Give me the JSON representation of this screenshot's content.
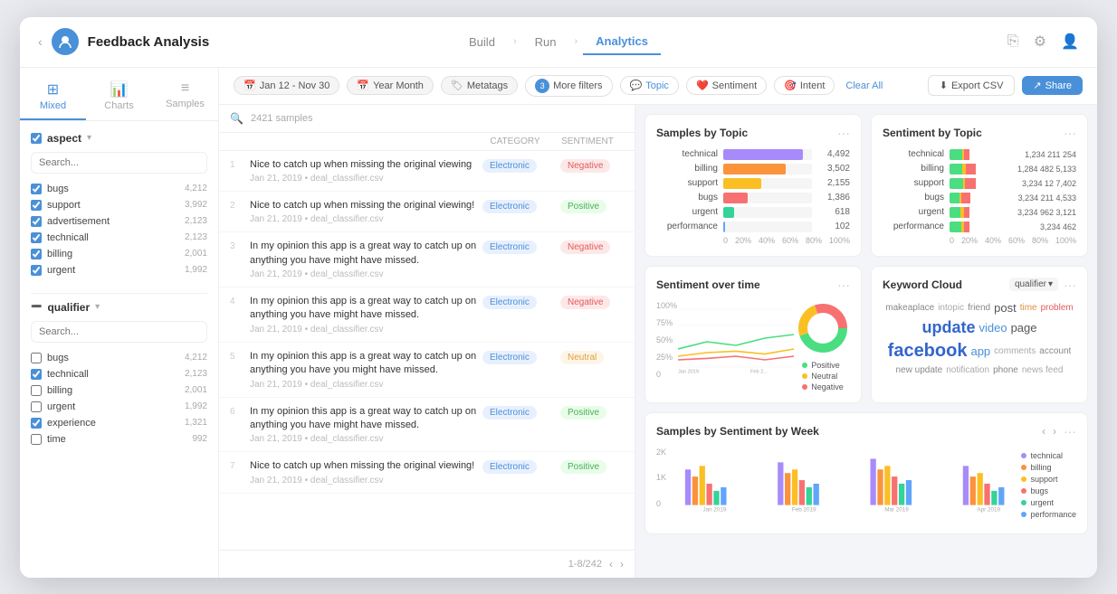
{
  "app": {
    "title": "Feedback Analysis",
    "nav": {
      "back": "‹",
      "items": [
        {
          "label": "Build",
          "active": false
        },
        {
          "label": "Run",
          "active": false
        },
        {
          "label": "Analytics",
          "active": true
        }
      ]
    },
    "toolbar_icons": [
      "copy-icon",
      "settings-icon",
      "user-icon"
    ]
  },
  "sidebar": {
    "tabs": [
      {
        "label": "Mixed",
        "icon": "⊞",
        "active": true
      },
      {
        "label": "Charts",
        "icon": "📊",
        "active": false
      },
      {
        "label": "Samples",
        "icon": "≡",
        "active": false
      }
    ],
    "aspect_group": {
      "title": "aspect",
      "search_placeholder": "Search...",
      "items": [
        {
          "label": "bugs",
          "count": "4,212",
          "checked": true
        },
        {
          "label": "support",
          "count": "3,992",
          "checked": true
        },
        {
          "label": "advertisement",
          "count": "2,123",
          "checked": true
        },
        {
          "label": "technicall",
          "count": "2,123",
          "checked": true
        },
        {
          "label": "billing",
          "count": "2,001",
          "checked": true
        },
        {
          "label": "urgent",
          "count": "1,992",
          "checked": true
        }
      ]
    },
    "qualifier_group": {
      "title": "qualifier",
      "search_placeholder": "Search...",
      "items": [
        {
          "label": "bugs",
          "count": "4,212",
          "checked": false
        },
        {
          "label": "technicall",
          "count": "2,123",
          "checked": true
        },
        {
          "label": "billing",
          "count": "2,001",
          "checked": false
        },
        {
          "label": "urgent",
          "count": "1,992",
          "checked": false
        },
        {
          "label": "experience",
          "count": "1,321",
          "checked": true
        },
        {
          "label": "time",
          "count": "992",
          "checked": false
        }
      ]
    }
  },
  "filter_bar": {
    "date_range": "Jan 12 - Nov 30",
    "period": "Year Month",
    "metatags": "Metatags",
    "more_filters_count": "3",
    "more_filters_label": "More filters",
    "topic_label": "Topic",
    "sentiment_label": "Sentiment",
    "intent_label": "Intent",
    "clear_all": "Clear All",
    "export_csv": "Export CSV",
    "share": "Share"
  },
  "table": {
    "samples_count": "2421 samples",
    "col_category": "CATEGORY",
    "col_sentiment": "SENTIMENT",
    "pagination": "1-8/242",
    "rows": [
      {
        "num": 1,
        "text": "Nice to catch up when missing the original viewing",
        "meta": "Jan 21, 2019 • deal_classifier.csv",
        "category": "Electronic",
        "sentiment": "Negative"
      },
      {
        "num": 2,
        "text": "Nice to catch up when missing the original viewing!",
        "meta": "Jan 21, 2019 • deal_classifier.csv",
        "category": "Electronic",
        "sentiment": "Positive"
      },
      {
        "num": 3,
        "text": "In my opinion this app is a great way to catch up on anything you have might have missed.",
        "meta": "Jan 21, 2019 • deal_classifier.csv",
        "category": "Electronic",
        "sentiment": "Negative"
      },
      {
        "num": 4,
        "text": "In my opinion this app is a great way to catch up on anything you have might have missed.",
        "meta": "Jan 21, 2019 • deal_classifier.csv",
        "category": "Electronic",
        "sentiment": "Negative"
      },
      {
        "num": 5,
        "text": "In my opinion this app is a great way to catch up on anything you have you might have missed.",
        "meta": "Jan 21, 2019 • deal_classifier.csv",
        "category": "Electronic",
        "sentiment": "Neutral"
      },
      {
        "num": 6,
        "text": "In my opinion this app is a great way to catch up on anything you have might have missed.",
        "meta": "Jan 21, 2019 • deal_classifier.csv",
        "category": "Electronic",
        "sentiment": "Positive"
      },
      {
        "num": 7,
        "text": "Nice to catch up when missing the original viewing!",
        "meta": "Jan 21, 2019 • deal_classifier.csv",
        "category": "Electronic",
        "sentiment": "Positive"
      }
    ]
  },
  "charts": {
    "samples_by_topic": {
      "title": "Samples by Topic",
      "rows": [
        {
          "label": "technical",
          "value": "4,492",
          "pct": 90,
          "color": "#a78bfa"
        },
        {
          "label": "billing",
          "value": "3,502",
          "pct": 70,
          "color": "#fb923c"
        },
        {
          "label": "support",
          "value": "2,155",
          "pct": 43,
          "color": "#fbbf24"
        },
        {
          "label": "bugs",
          "value": "1,386",
          "pct": 28,
          "color": "#f87171"
        },
        {
          "label": "urgent",
          "value": "618",
          "pct": 12,
          "color": "#34d399"
        },
        {
          "label": "performance",
          "value": "102",
          "pct": 2,
          "color": "#60a5fa"
        }
      ],
      "x_labels": [
        "0",
        "20%",
        "40%",
        "60%",
        "80%",
        "100%"
      ]
    },
    "sentiment_by_topic": {
      "title": "Sentiment by Topic",
      "rows": [
        {
          "label": "technical",
          "segs": [
            {
              "pct": 25,
              "color": "#4ade80"
            },
            {
              "pct": 5,
              "color": "#fbbf24"
            },
            {
              "pct": 10,
              "color": "#f87171"
            }
          ],
          "values": "1,234  211  254"
        },
        {
          "label": "billing",
          "segs": [
            {
              "pct": 25,
              "color": "#4ade80"
            },
            {
              "pct": 8,
              "color": "#fbbf24"
            },
            {
              "pct": 20,
              "color": "#f87171"
            }
          ],
          "values": "1,284  482  5,133"
        },
        {
          "label": "support",
          "segs": [
            {
              "pct": 28,
              "color": "#4ade80"
            },
            {
              "pct": 3,
              "color": "#fbbf24"
            },
            {
              "pct": 22,
              "color": "#f87171"
            }
          ],
          "values": "3,234  12  7,402"
        },
        {
          "label": "bugs",
          "segs": [
            {
              "pct": 20,
              "color": "#4ade80"
            },
            {
              "pct": 5,
              "color": "#fbbf24"
            },
            {
              "pct": 18,
              "color": "#f87171"
            }
          ],
          "values": "3,234  211  4,533"
        },
        {
          "label": "urgent",
          "segs": [
            {
              "pct": 22,
              "color": "#4ade80"
            },
            {
              "pct": 7,
              "color": "#fbbf24"
            },
            {
              "pct": 12,
              "color": "#f87171"
            }
          ],
          "values": "3,234  962  3,121"
        },
        {
          "label": "performance",
          "segs": [
            {
              "pct": 24,
              "color": "#4ade80"
            },
            {
              "pct": 6,
              "color": "#fbbf24"
            },
            {
              "pct": 10,
              "color": "#f87171"
            }
          ],
          "values": "3,234  462"
        }
      ],
      "x_labels": [
        "0",
        "20%",
        "40%",
        "60%",
        "80%",
        "100%"
      ]
    },
    "sentiment_over_time": {
      "title": "Sentiment over time",
      "y_labels": [
        "100%",
        "75%",
        "50%",
        "25%",
        "0"
      ],
      "x_labels": [
        "Jan 2019",
        "Feb 2..."
      ],
      "legend": [
        {
          "label": "Positive",
          "color": "#4ade80"
        },
        {
          "label": "Neutral",
          "color": "#fbbf24"
        },
        {
          "label": "Negative",
          "color": "#f87171"
        }
      ],
      "donut": {
        "positive": 45,
        "neutral": 25,
        "negative": 30
      }
    },
    "keyword_cloud": {
      "title": "Keyword Cloud",
      "dropdown": "qualifier",
      "keywords": [
        {
          "text": "makeaplace",
          "size": "small"
        },
        {
          "text": "intopic",
          "size": "small"
        },
        {
          "text": "friend",
          "size": "small"
        },
        {
          "text": "post",
          "size": "medium"
        },
        {
          "text": "time",
          "size": "small",
          "color": "orange"
        },
        {
          "text": "problem",
          "size": "small",
          "color": "red"
        },
        {
          "text": "update",
          "size": "large"
        },
        {
          "text": "video",
          "size": "medium"
        },
        {
          "text": "page",
          "size": "medium"
        },
        {
          "text": "facebook",
          "size": "large"
        },
        {
          "text": "app",
          "size": "medium"
        },
        {
          "text": "comments",
          "size": "small"
        },
        {
          "text": "account",
          "size": "small"
        },
        {
          "text": "new update",
          "size": "small"
        },
        {
          "text": "notification",
          "size": "small"
        },
        {
          "text": "phone",
          "size": "small"
        },
        {
          "text": "news feed",
          "size": "small"
        }
      ]
    },
    "samples_by_sentiment_week": {
      "title": "Samples by Sentiment by Week",
      "y_labels": [
        "2K",
        "1K",
        "0"
      ],
      "x_labels": [
        "Jan 2019",
        "Feb 2019",
        "Mar 2019",
        "Apr 2019"
      ],
      "legend": [
        {
          "label": "technical",
          "color": "#a78bfa"
        },
        {
          "label": "billing",
          "color": "#fb923c"
        },
        {
          "label": "support",
          "color": "#fbbf24"
        },
        {
          "label": "bugs",
          "color": "#f87171"
        },
        {
          "label": "urgent",
          "color": "#34d399"
        },
        {
          "label": "performance",
          "color": "#60a5fa"
        }
      ]
    }
  }
}
